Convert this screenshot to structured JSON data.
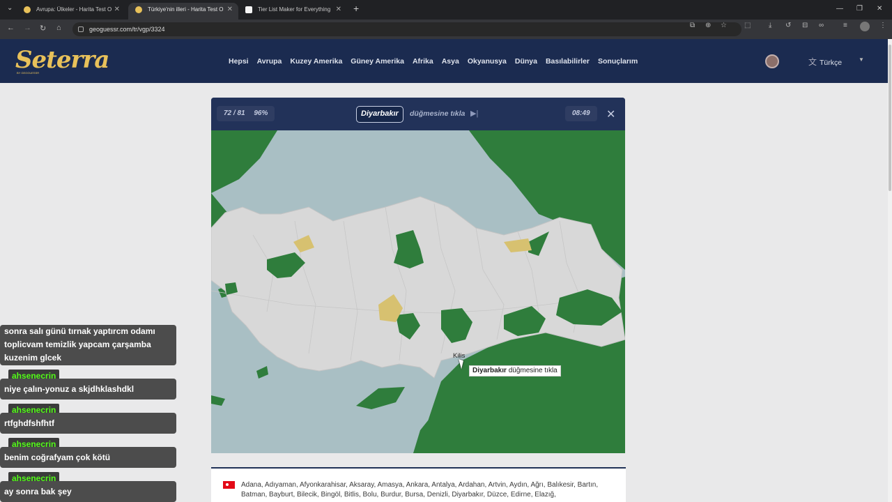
{
  "browser": {
    "tabs": [
      {
        "title": "Avrupa: Ülkeler - Harita Test O",
        "active": false,
        "favicon_color": "#e8c15a"
      },
      {
        "title": "Türkiye'nin illeri - Harita Test O",
        "active": true,
        "favicon_color": "#e8c15a"
      },
      {
        "title": "Tier List Maker for Everything",
        "active": false,
        "favicon_color": "#f5f5f5"
      }
    ],
    "new_tab_label": "+",
    "url": "geoguessr.com/tr/vgp/3324"
  },
  "site": {
    "logo_text": "Seterra",
    "logo_sub": "BY GEOGUESSR",
    "nav": [
      "Hepsi",
      "Avrupa",
      "Kuzey Amerika",
      "Güney Amerika",
      "Afrika",
      "Asya",
      "Okyanusya",
      "Dünya",
      "Basılabilirler",
      "Sonuçlarım"
    ],
    "language": "Türkçe"
  },
  "game": {
    "progress": "72 / 81",
    "score": "96%",
    "target": "Diyarbakır",
    "prompt_suffix": "düğmesine tıkla",
    "timer": "08:49",
    "map_label": "Kilis",
    "hint_target": "Diyarbakır",
    "hint_suffix": " düğmesine tıkla"
  },
  "chat": [
    {
      "user": "",
      "text": "sonra salı günü tırnak yaptırcm odamı toplicvam temizlik yapcam çarşamba kuzenim glcek"
    },
    {
      "user": "ahsenecrin",
      "text": "niye çalın-yonuz a skjdhklashdkl"
    },
    {
      "user": "ahsenecrin",
      "text": "rtfghdfshfhtf"
    },
    {
      "user": "ahsenecrin",
      "text": "benim coğrafyam çok kötü"
    },
    {
      "user": "ahsenecrin",
      "text": "ay sonra bak şey"
    }
  ],
  "provinces_list": "Adana, Adıyaman, Afyonkarahisar, Aksaray, Amasya, Ankara, Antalya, Ardahan, Artvin, Aydın, Ağrı, Balıkesir, Bartın, Batman, Bayburt, Bilecik, Bingöl, Bitlis, Bolu, Burdur, Bursa, Denizli, Diyarbakır, Düzce, Edirne, Elazığ,",
  "colors": {
    "header": "#1b2b50",
    "panel": "#203157",
    "correct": "#2f7d3c",
    "wrong": "#d7c170",
    "land": "#d8d8d8",
    "sea": "#a9bfc4",
    "chat_name": "#53fc18"
  }
}
